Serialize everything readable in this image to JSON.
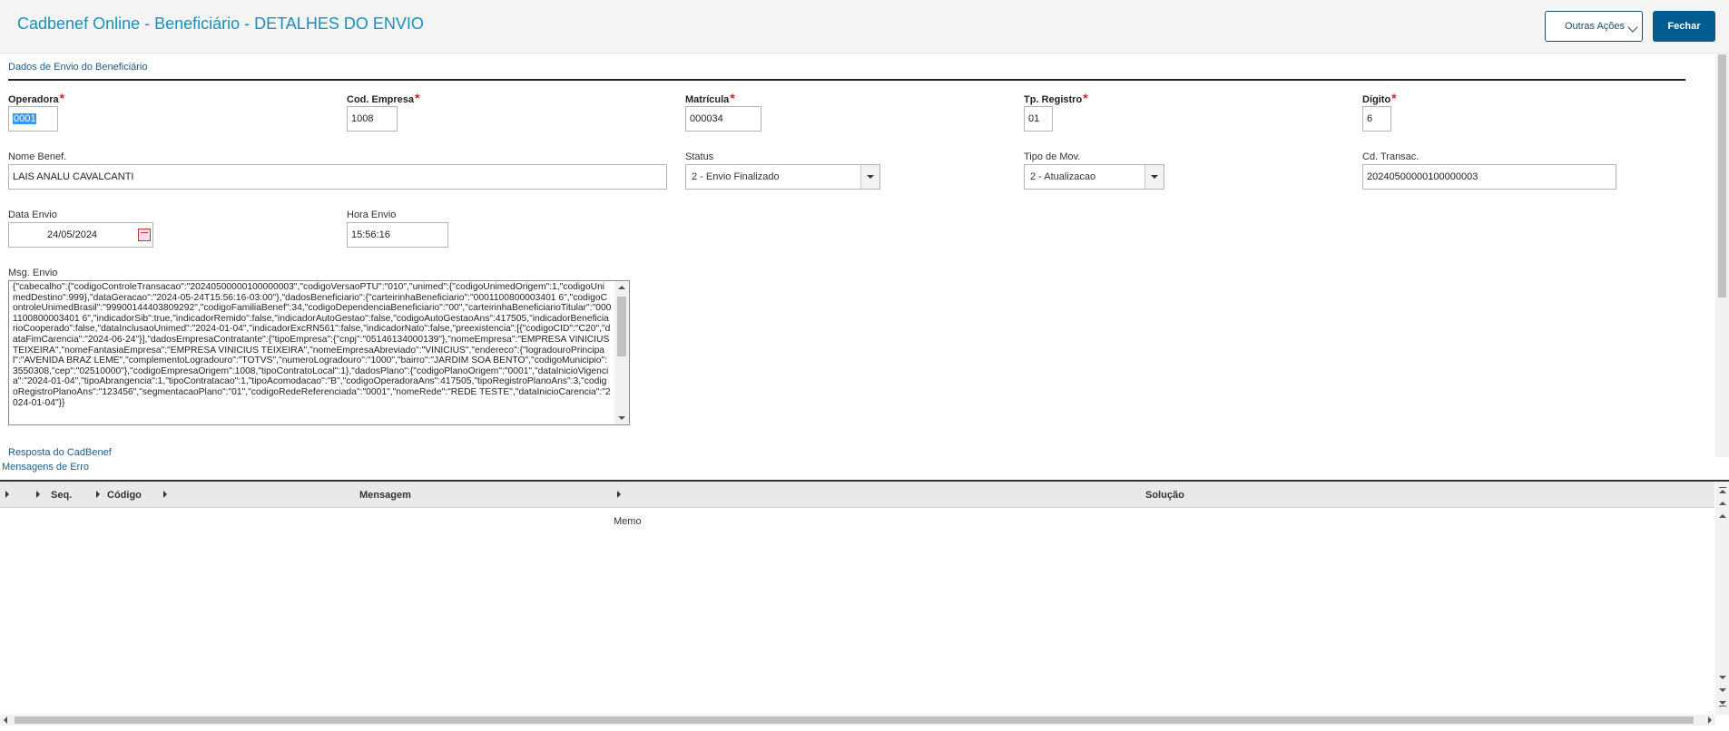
{
  "header": {
    "title": "Cadbenef Online - Beneficiário - DETALHES DO ENVIO",
    "other_actions_label": "Outras Ações",
    "close_label": "Fechar"
  },
  "section": {
    "title": "Dados de Envio do Beneficiário"
  },
  "fields": {
    "operadora": {
      "label": "Operadora",
      "value": "0001"
    },
    "cod_empresa": {
      "label": "Cod. Empresa",
      "value": "1008"
    },
    "matricula": {
      "label": "Matrícula",
      "value": "000034"
    },
    "tp_registro": {
      "label": "Tp. Registro",
      "value": "01"
    },
    "digito": {
      "label": "Dígito",
      "value": "6"
    },
    "nome_benef": {
      "label": "Nome Benef.",
      "value": "LAIS ANALU CAVALCANTI"
    },
    "status": {
      "label": "Status",
      "value": "2 - Envio Finalizado"
    },
    "tipo_mov": {
      "label": "Tipo de Mov.",
      "value": "2 - Atualizacao"
    },
    "cd_transac": {
      "label": "Cd. Transac.",
      "value": "20240500000100000003"
    },
    "data_envio": {
      "label": "Data Envio",
      "value": "24/05/2024"
    },
    "hora_envio": {
      "label": "Hora Envio",
      "value": "15:56:16"
    },
    "msg_envio": {
      "label": "Msg. Envio",
      "value": "{\"cabecalho\":{\"codigoControleTransacao\":\"20240500000100000003\",\"codigoVersaoPTU\":\"010\",\"unimed\":{\"codigoUnimedOrigem\":1,\"codigoUnimedDestino\":999},\"dataGeracao\":\"2024-05-24T15:56:16-03:00\"},\"dadosBeneficiario\":{\"carteirinhaBeneficiario\":\"0001100800003401 6\",\"codigoControleUnimedBrasil\":\"99900144403809292\",\"codigoFamiliaBenef\":34,\"codigoDependenciaBeneficiario\":\"00\",\"carteirinhaBeneficiarioTitular\":\"0001100800003401 6\",\"indicadorSib\":true,\"indicadorRemido\":false,\"indicadorAutoGestao\":false,\"codigoAutoGestaoAns\":417505,\"indicadorBeneficiarioCooperado\":false,\"dataInclusaoUnimed\":\"2024-01-04\",\"indicadorExcRN561\":false,\"indicadorNato\":false,\"preexistencia\":[{\"codigoCID\":\"C20\",\"dataFimCarencia\":\"2024-06-24\"}],\"dadosEmpresaContratante\":{\"tipoEmpresa\":{\"cnpj\":\"05146134000139\"},\"nomeEmpresa\":\"EMPRESA VINICIUS TEIXEIRA\",\"nomeFantasiaEmpresa\":\"EMPRESA VINICIUS TEIXEIRA\",\"nomeEmpresaAbreviado\":\"VINICIUS\",\"endereco\":{\"logradouroPrincipal\":\"AVENIDA BRAZ LEME\",\"complementoLogradouro\":\"TOTVS\",\"numeroLogradouro\":\"1000\",\"bairro\":\"JARDIM SOA BENTO\",\"codigoMunicipio\":3550308,\"cep\":\"02510000\"},\"codigoEmpresaOrigem\":1008,\"tipoContratoLocal\":1},\"dadosPlano\":{\"codigoPlanoOrigem\":\"0001\",\"dataInicioVigencia\":\"2024-01-04\",\"tipoAbrangencia\":1,\"tipoContratacao\":1,\"tipoAcomodacao\":\"B\",\"codigoOperadoraAns\":417505,\"tipoRegistroPlanoAns\":3,\"codigoRegistroPlanoAns\":\"123456\",\"segmentacaoPlano\":\"01\",\"codigoRedeReferenciada\":\"0001\",\"nomeRede\":\"REDE TESTE\",\"dataInicioCarencia\":\"2024-01-04\"}}"
    }
  },
  "response_label": "Resposta do CadBenef",
  "errors": {
    "title": "Mensagens de Erro",
    "columns": [
      "Seq.",
      "Código",
      "Mensagem",
      "Solução"
    ],
    "memo_cell": "Memo"
  }
}
